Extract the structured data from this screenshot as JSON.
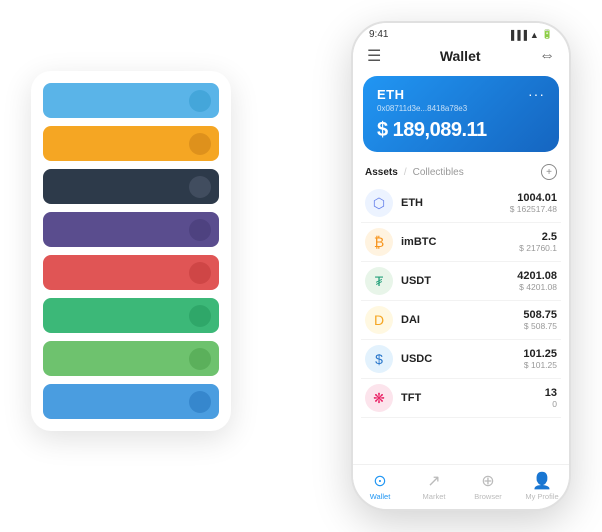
{
  "scene": {
    "bg_card": {
      "rows": [
        {
          "color": "#5ab4e8",
          "dot_color": "#3a9fd4"
        },
        {
          "color": "#f5a623",
          "dot_color": "#d4891a"
        },
        {
          "color": "#2d3a4a",
          "dot_color": "#4a5568"
        },
        {
          "color": "#5a4d8e",
          "dot_color": "#483d7a"
        },
        {
          "color": "#e05555",
          "dot_color": "#c74040"
        },
        {
          "color": "#3cb878",
          "dot_color": "#2a9f62"
        },
        {
          "color": "#6ec26e",
          "dot_color": "#52a852"
        },
        {
          "color": "#4a9de0",
          "dot_color": "#2e7ec4"
        }
      ]
    },
    "phone": {
      "status_time": "9:41",
      "header_title": "Wallet",
      "eth_card": {
        "label": "ETH",
        "address": "0x08711d3e...8418a78e3",
        "balance": "$ 189,089.11"
      },
      "assets_tab_active": "Assets",
      "assets_tab_inactive": "Collectibles",
      "assets": [
        {
          "symbol": "ETH",
          "qty": "1004.01",
          "usd": "$ 162517.48",
          "icon": "♦",
          "type": "eth"
        },
        {
          "symbol": "imBTC",
          "qty": "2.5",
          "usd": "$ 21760.1",
          "icon": "₿",
          "type": "imbtc"
        },
        {
          "symbol": "USDT",
          "qty": "4201.08",
          "usd": "$ 4201.08",
          "icon": "₮",
          "type": "usdt"
        },
        {
          "symbol": "DAI",
          "qty": "508.75",
          "usd": "$ 508.75",
          "icon": "◈",
          "type": "dai"
        },
        {
          "symbol": "USDC",
          "qty": "101.25",
          "usd": "$ 101.25",
          "icon": "©",
          "type": "usdc"
        },
        {
          "symbol": "TFT",
          "qty": "13",
          "usd": "0",
          "icon": "🌿",
          "type": "tft"
        }
      ],
      "nav": [
        {
          "label": "Wallet",
          "icon": "⊙",
          "active": true
        },
        {
          "label": "Market",
          "icon": "📈",
          "active": false
        },
        {
          "label": "Browser",
          "icon": "⊕",
          "active": false
        },
        {
          "label": "My Profile",
          "icon": "👤",
          "active": false
        }
      ]
    }
  }
}
